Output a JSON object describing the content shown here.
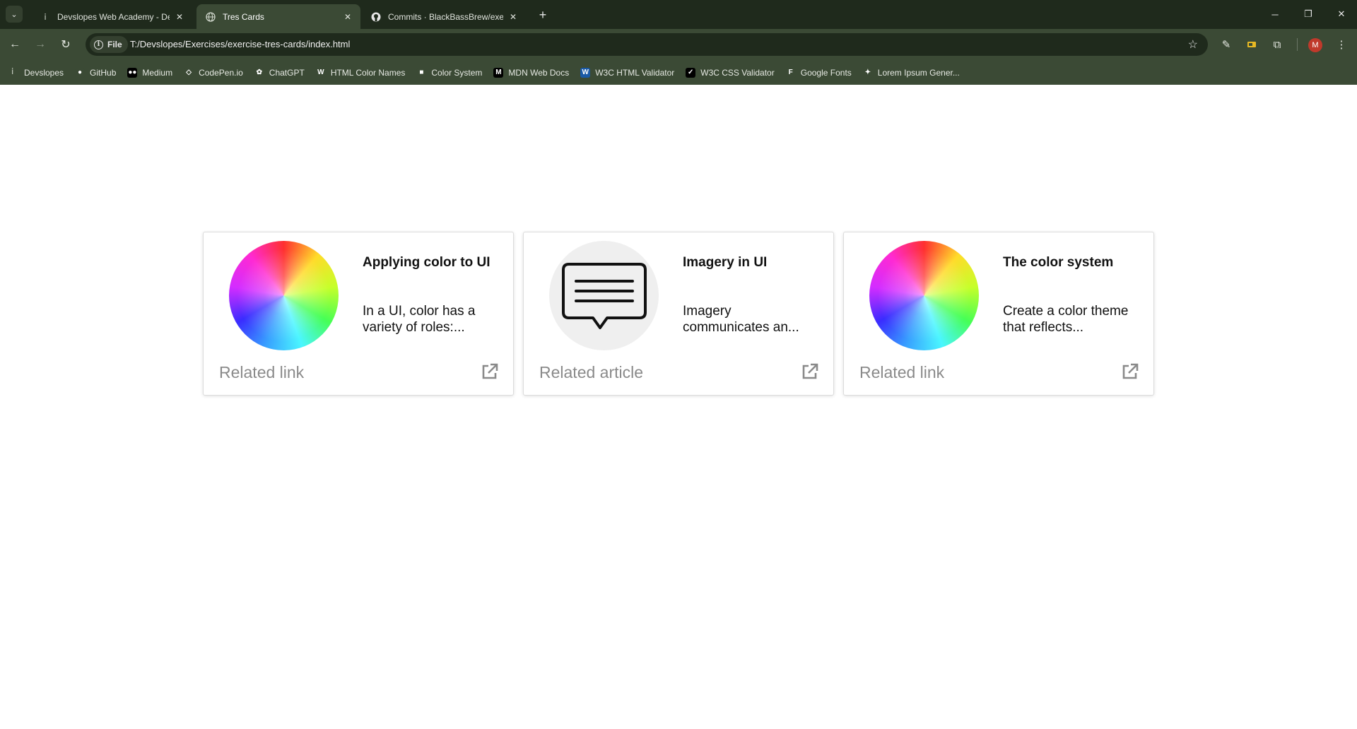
{
  "browser": {
    "tabs": [
      {
        "title": "Devslopes Web Academy - Dev",
        "icon": "devslopes-icon",
        "active": false
      },
      {
        "title": "Tres Cards",
        "icon": "globe-icon",
        "active": true
      },
      {
        "title": "Commits · BlackBassBrew/exerc",
        "icon": "github-icon",
        "active": false
      }
    ],
    "new_tab_label": "+",
    "site_chip_label": "File",
    "url": "T:/Devslopes/Exercises/exercise-tres-cards/index.html",
    "avatar_letter": "M"
  },
  "bookmarks": [
    {
      "label": "Devslopes",
      "icon": "devslopes-icon",
      "icon_text": "",
      "icon_color": "#3b4a35"
    },
    {
      "label": "GitHub",
      "icon": "github-icon",
      "icon_text": "●",
      "icon_color": "#3b4a35"
    },
    {
      "label": "Medium",
      "icon": "medium-icon",
      "icon_text": "●●",
      "icon_color": "#000000"
    },
    {
      "label": "CodePen.io",
      "icon": "codepen-icon",
      "icon_text": "◇",
      "icon_color": "#3b4a35"
    },
    {
      "label": "ChatGPT",
      "icon": "chatgpt-icon",
      "icon_text": "✿",
      "icon_color": "#3b4a35"
    },
    {
      "label": "HTML Color Names",
      "icon": "htmlcolor-icon",
      "icon_text": "W",
      "icon_color": "#3b4a35"
    },
    {
      "label": "Color System",
      "icon": "colorsystem-icon",
      "icon_text": "■",
      "icon_color": "#3b4a35"
    },
    {
      "label": "MDN Web Docs",
      "icon": "mdn-icon",
      "icon_text": "M",
      "icon_color": "#000000"
    },
    {
      "label": "W3C HTML Validator",
      "icon": "w3c-icon",
      "icon_text": "W",
      "icon_color": "#1a5aa6"
    },
    {
      "label": "W3C CSS Validator",
      "icon": "w3c-css-icon",
      "icon_text": "✓",
      "icon_color": "#000000"
    },
    {
      "label": "Google Fonts",
      "icon": "googlefonts-icon",
      "icon_text": "F",
      "icon_color": "#3b4a35"
    },
    {
      "label": "Lorem Ipsum Gener...",
      "icon": "lorem-icon",
      "icon_text": "✦",
      "icon_color": "#3b4a35"
    }
  ],
  "cards": [
    {
      "title": "Applying color to UI",
      "description": "In a UI, color has a variety of roles:...",
      "link": "Related link",
      "image": "color-wheel"
    },
    {
      "title": "Imagery in UI",
      "description": "Imagery communicates an...",
      "link": "Related article",
      "image": "chat-bubble"
    },
    {
      "title": "The color system",
      "description": "Create a color theme that reflects...",
      "link": "Related link",
      "image": "color-wheel"
    }
  ],
  "colors": {
    "chrome_dark": "#1f2a1c",
    "chrome_light": "#3b4a35",
    "link_gray": "#8a8a8a"
  }
}
